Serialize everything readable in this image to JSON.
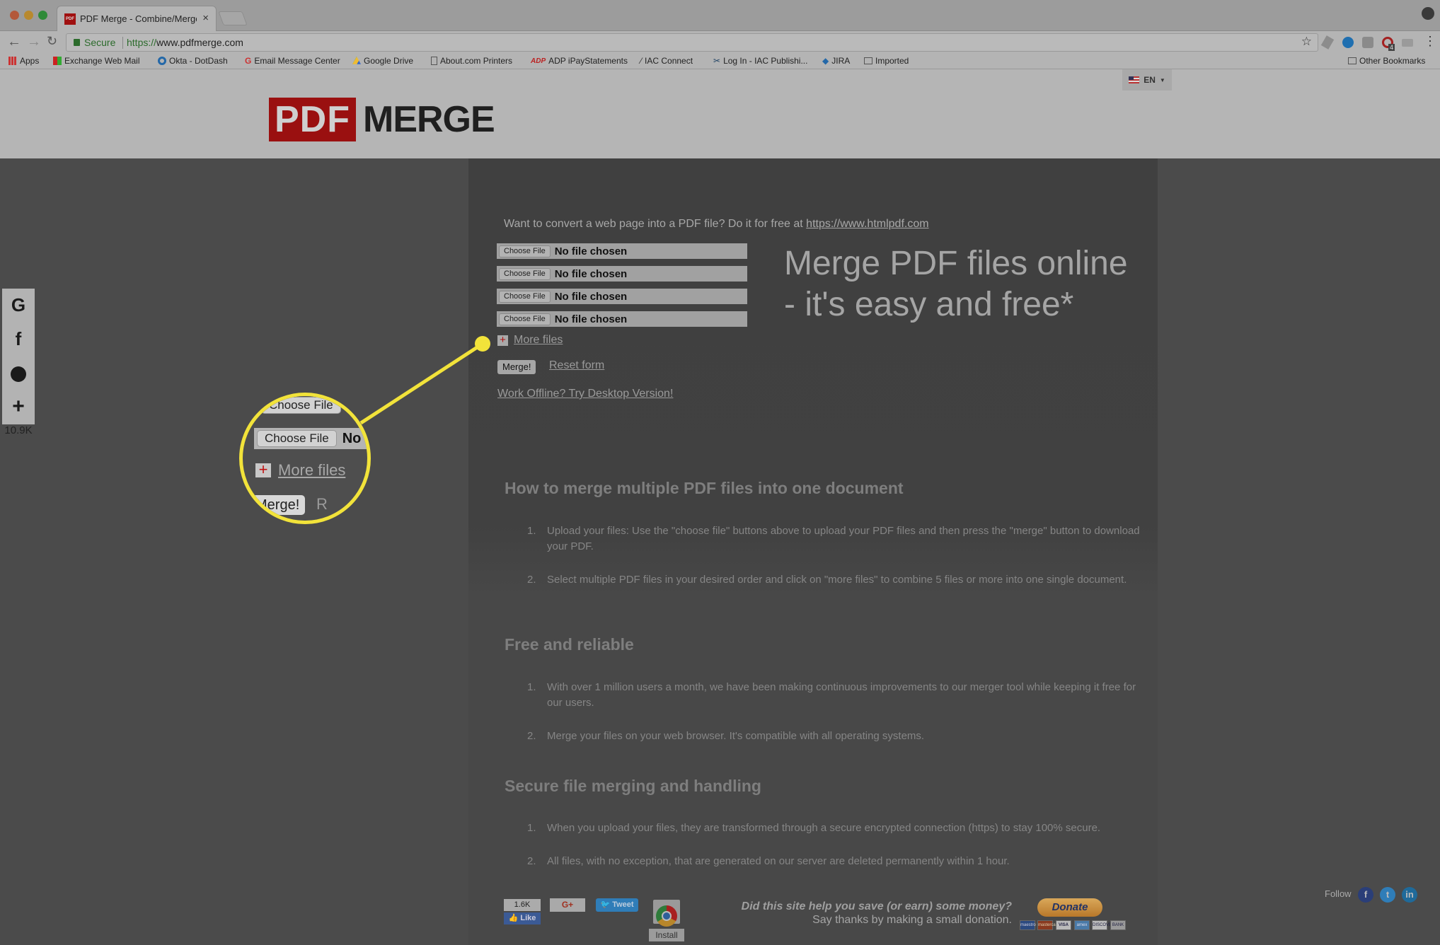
{
  "browser": {
    "tab_title": "PDF Merge - Combine/Merge PDF",
    "tab_favicon": "PDF",
    "security_label": "Secure",
    "url_scheme": "https://",
    "url_host": "www.pdfmerge.com",
    "bookmarks": [
      {
        "label": "Apps",
        "icon": "apps-grid-icon"
      },
      {
        "label": "Exchange Web Mail",
        "icon": "windows-icon"
      },
      {
        "label": "Okta - DotDash",
        "icon": "okta-icon"
      },
      {
        "label": "Email Message Center",
        "icon": "google-g-icon"
      },
      {
        "label": "Google Drive",
        "icon": "google-drive-icon"
      },
      {
        "label": "About.com Printers",
        "icon": "page-icon"
      },
      {
        "label": "ADP iPayStatements",
        "icon": "adp-icon"
      },
      {
        "label": "IAC Connect",
        "icon": "quill-icon"
      },
      {
        "label": "Log In - IAC Publishi...",
        "icon": "scissors-icon"
      },
      {
        "label": "JIRA",
        "icon": "jira-icon"
      },
      {
        "label": "Imported",
        "icon": "folder-icon"
      }
    ],
    "other_bookmarks": "Other Bookmarks",
    "extension_badge": "4"
  },
  "header": {
    "logo_left": "PDF",
    "logo_right": "MERGE",
    "language": "EN"
  },
  "social_sidebar": {
    "items": [
      {
        "glyph": "G",
        "name": "google"
      },
      {
        "glyph": "f",
        "name": "facebook"
      },
      {
        "glyph": "✆",
        "name": "messenger"
      },
      {
        "glyph": "+",
        "name": "more"
      }
    ],
    "share_count": "10.9K"
  },
  "promo": {
    "text": "Want to convert a web page into a PDF file? Do it for free at ",
    "link": "https://www.htmlpdf.com"
  },
  "form": {
    "file_inputs": [
      {
        "button": "Choose File",
        "status": "No file chosen"
      },
      {
        "button": "Choose File",
        "status": "No file chosen"
      },
      {
        "button": "Choose File",
        "status": "No file chosen"
      },
      {
        "button": "Choose File",
        "status": "No file chosen"
      }
    ],
    "more_files_icon": "+",
    "more_files": "More files",
    "merge_button": "Merge!",
    "reset": "Reset form",
    "offline": "Work Offline? Try Desktop Version!"
  },
  "hero": "Merge PDF files online - it's easy and free*",
  "sections": [
    {
      "heading": "How to merge multiple PDF files into one document",
      "items": [
        "Upload your files: Use the \"choose file\" buttons above to upload your PDF files and then press the \"merge\" button to download your PDF.",
        "Select multiple PDF files in your desired order and click on \"more files\" to combine 5 files or more into one single document."
      ]
    },
    {
      "heading": "Free and reliable",
      "items": [
        "With over 1 million users a month, we have been making continuous improvements to our merger tool while keeping it free for our users.",
        "Merge your files on your web browser. It's compatible with all operating systems."
      ]
    },
    {
      "heading": "Secure file merging and handling",
      "items": [
        "When you upload your files, they are transformed through a secure encrypted connection (https) to stay 100% secure.",
        "All files, with no exception, that are generated on our server are deleted permanently within 1 hour."
      ]
    }
  ],
  "footer": {
    "fb_count": "1.6K",
    "fb_like": "Like",
    "gplus": "G+",
    "tweet": "Tweet",
    "install": "Install",
    "donate_question": "Did this site help you save (or earn) some money?",
    "donate_subtext": "Say thanks by making a small donation.",
    "donate_button": "Donate",
    "cards": [
      "maestro",
      "mastercard",
      "VISA",
      "amex",
      "DISCOVER",
      "BANK"
    ],
    "follow_label": "Follow",
    "follow_networks": [
      "f",
      "t",
      "in"
    ]
  },
  "callout": {
    "color": "#f2e33a",
    "lens_rows": [
      {
        "button": "Choose File",
        "status": ""
      },
      {
        "button": "Choose File",
        "status": "No"
      }
    ],
    "lens_more_files": "More files",
    "lens_merge": "Merge!",
    "lens_reset_fragment": "R"
  },
  "colors": {
    "logo_red": "#9a1010",
    "panel": "#414141",
    "page_bg": "#4b4b4b"
  }
}
